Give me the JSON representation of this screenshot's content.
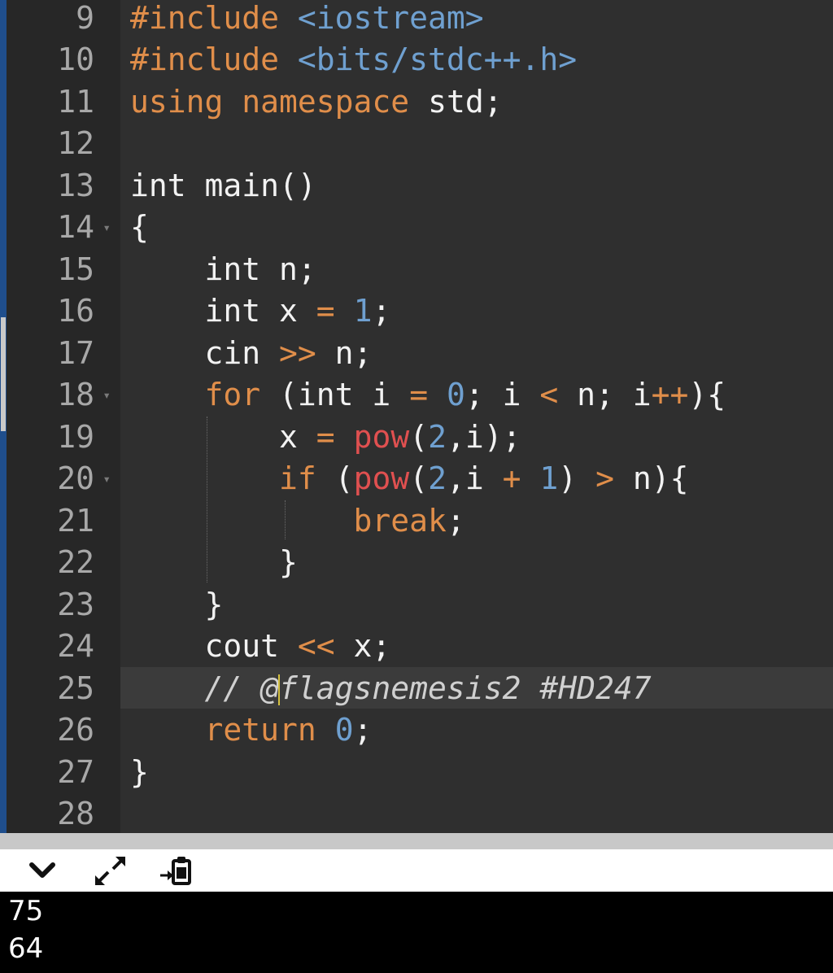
{
  "editor": {
    "lines": [
      {
        "n": "9",
        "fold": false,
        "tokens": [
          {
            "t": "#include ",
            "c": "kw"
          },
          {
            "t": "<iostream>",
            "c": "str"
          }
        ]
      },
      {
        "n": "10",
        "fold": false,
        "tokens": [
          {
            "t": "#include ",
            "c": "kw"
          },
          {
            "t": "<bits/stdc++.h>",
            "c": "str"
          }
        ]
      },
      {
        "n": "11",
        "fold": false,
        "tokens": [
          {
            "t": "using ",
            "c": "kw"
          },
          {
            "t": "namespace ",
            "c": "kw"
          },
          {
            "t": "std;",
            "c": ""
          }
        ]
      },
      {
        "n": "12",
        "fold": false,
        "tokens": []
      },
      {
        "n": "13",
        "fold": false,
        "tokens": [
          {
            "t": "int main()",
            "c": ""
          }
        ]
      },
      {
        "n": "14",
        "fold": true,
        "tokens": [
          {
            "t": "{",
            "c": ""
          }
        ]
      },
      {
        "n": "15",
        "fold": false,
        "tokens": [
          {
            "t": "    int n;",
            "c": ""
          }
        ]
      },
      {
        "n": "16",
        "fold": false,
        "tokens": [
          {
            "t": "    int x ",
            "c": ""
          },
          {
            "t": "=",
            "c": "op"
          },
          {
            "t": " ",
            "c": ""
          },
          {
            "t": "1",
            "c": "num"
          },
          {
            "t": ";",
            "c": ""
          }
        ]
      },
      {
        "n": "17",
        "fold": false,
        "tokens": [
          {
            "t": "    cin ",
            "c": ""
          },
          {
            "t": ">>",
            "c": "op"
          },
          {
            "t": " n;",
            "c": ""
          }
        ]
      },
      {
        "n": "18",
        "fold": true,
        "tokens": [
          {
            "t": "    ",
            "c": ""
          },
          {
            "t": "for",
            "c": "kw"
          },
          {
            "t": " (int i ",
            "c": ""
          },
          {
            "t": "=",
            "c": "op"
          },
          {
            "t": " ",
            "c": ""
          },
          {
            "t": "0",
            "c": "num"
          },
          {
            "t": "; i ",
            "c": ""
          },
          {
            "t": "<",
            "c": "op"
          },
          {
            "t": " n; i",
            "c": ""
          },
          {
            "t": "++",
            "c": "op"
          },
          {
            "t": "){",
            "c": ""
          }
        ]
      },
      {
        "n": "19",
        "fold": false,
        "tokens": [
          {
            "t": "        x ",
            "c": ""
          },
          {
            "t": "=",
            "c": "op"
          },
          {
            "t": " ",
            "c": ""
          },
          {
            "t": "pow",
            "c": "fn"
          },
          {
            "t": "(",
            "c": ""
          },
          {
            "t": "2",
            "c": "num"
          },
          {
            "t": ",i);",
            "c": ""
          }
        ]
      },
      {
        "n": "20",
        "fold": true,
        "tokens": [
          {
            "t": "        ",
            "c": ""
          },
          {
            "t": "if",
            "c": "kw"
          },
          {
            "t": " (",
            "c": ""
          },
          {
            "t": "pow",
            "c": "fn"
          },
          {
            "t": "(",
            "c": ""
          },
          {
            "t": "2",
            "c": "num"
          },
          {
            "t": ",i ",
            "c": ""
          },
          {
            "t": "+",
            "c": "op"
          },
          {
            "t": " ",
            "c": ""
          },
          {
            "t": "1",
            "c": "num"
          },
          {
            "t": ") ",
            "c": ""
          },
          {
            "t": ">",
            "c": "op"
          },
          {
            "t": " n){",
            "c": ""
          }
        ]
      },
      {
        "n": "21",
        "fold": false,
        "tokens": [
          {
            "t": "            ",
            "c": ""
          },
          {
            "t": "break",
            "c": "kw"
          },
          {
            "t": ";",
            "c": ""
          }
        ]
      },
      {
        "n": "22",
        "fold": false,
        "tokens": [
          {
            "t": "        }",
            "c": ""
          }
        ]
      },
      {
        "n": "23",
        "fold": false,
        "tokens": [
          {
            "t": "    }",
            "c": ""
          }
        ]
      },
      {
        "n": "24",
        "fold": false,
        "tokens": [
          {
            "t": "    cout ",
            "c": ""
          },
          {
            "t": "<<",
            "c": "op"
          },
          {
            "t": " x;",
            "c": ""
          }
        ]
      },
      {
        "n": "25",
        "fold": false,
        "tokens": [
          {
            "t": "    // @",
            "c": "cmt"
          },
          {
            "t": "|",
            "c": "caret"
          },
          {
            "t": "flagsnemesis2 #HD247",
            "c": "cmt"
          }
        ]
      },
      {
        "n": "26",
        "fold": false,
        "tokens": [
          {
            "t": "    ",
            "c": ""
          },
          {
            "t": "return",
            "c": "kw"
          },
          {
            "t": " ",
            "c": ""
          },
          {
            "t": "0",
            "c": "num"
          },
          {
            "t": ";",
            "c": ""
          }
        ]
      },
      {
        "n": "27",
        "fold": false,
        "tokens": [
          {
            "t": "}",
            "c": ""
          }
        ]
      },
      {
        "n": "28",
        "fold": false,
        "tokens": []
      }
    ]
  },
  "toolbar": {
    "collapse_icon": "chevron-down-icon",
    "expand_icon": "expand-arrows-icon",
    "clipboard_icon": "clipboard-paste-icon"
  },
  "console": {
    "output": [
      "75",
      "64"
    ]
  },
  "colors": {
    "editor_bg": "#2f2f2f",
    "gutter_bg": "#272727",
    "keyword": "#e08e4a",
    "string": "#6fa0d0",
    "function": "#e05050",
    "console_bg": "#000000"
  }
}
